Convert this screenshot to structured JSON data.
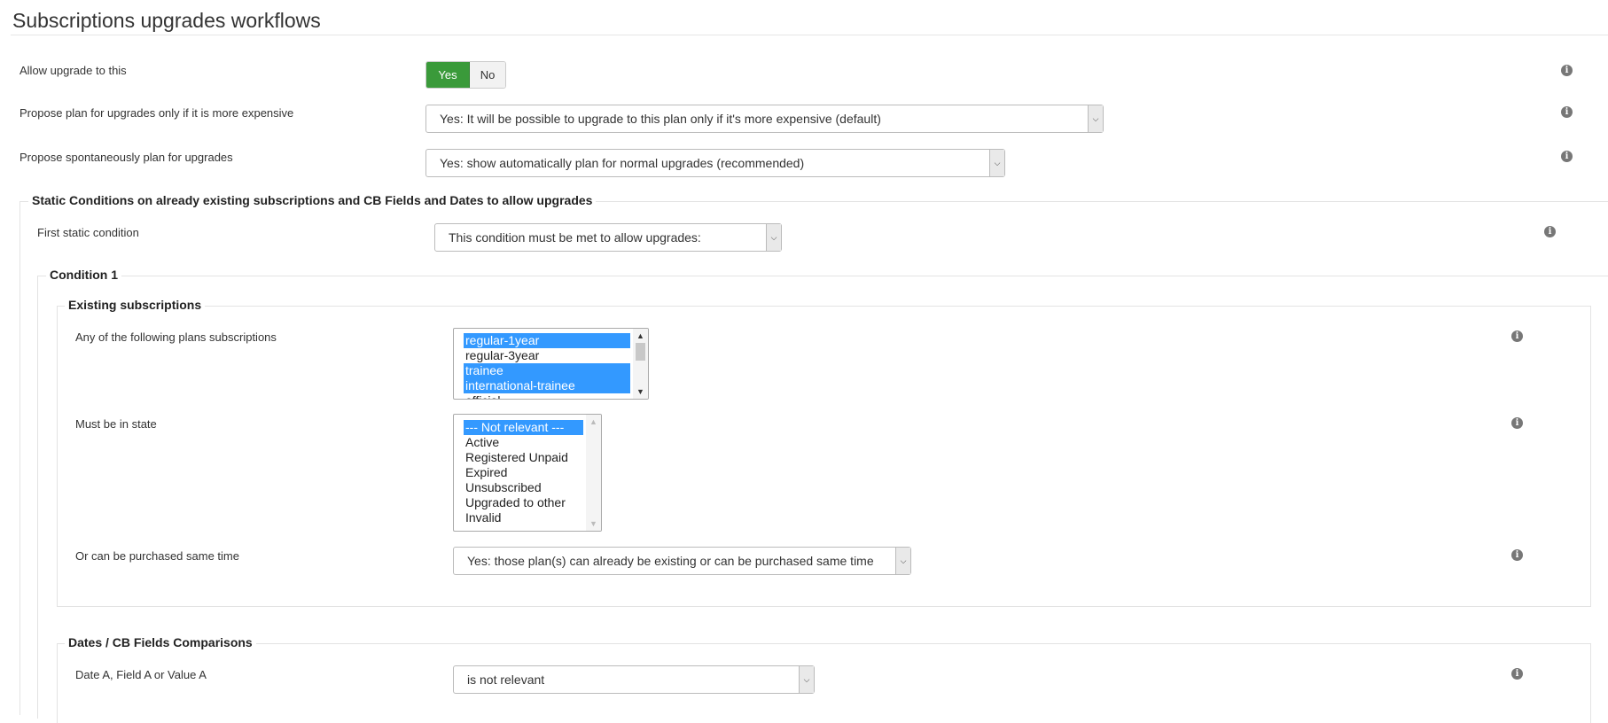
{
  "page": {
    "title": "Subscriptions upgrades workflows"
  },
  "upgrade": {
    "allow_label": "Allow upgrade to this",
    "toggle": {
      "yes": "Yes",
      "no": "No",
      "selected": "Yes"
    },
    "propose_expensive_label": "Propose plan for upgrades only if it is more expensive",
    "propose_expensive_value": "Yes: It will be possible to upgrade to this plan only if it's more expensive (default)",
    "propose_spontaneous_label": "Propose spontaneously plan for upgrades",
    "propose_spontaneous_value": "Yes: show automatically plan for normal upgrades (recommended)"
  },
  "static_conditions": {
    "legend": "Static Conditions on already existing subscriptions and CB Fields and Dates to allow upgrades",
    "first_label": "First static condition",
    "first_value": "This condition must be met to allow upgrades:",
    "condition1": {
      "legend": "Condition 1",
      "existing": {
        "legend": "Existing subscriptions",
        "plans_label": "Any of the following plans subscriptions",
        "plans_options": [
          {
            "label": "regular-1year",
            "selected": true
          },
          {
            "label": "regular-3year",
            "selected": false
          },
          {
            "label": "trainee",
            "selected": true
          },
          {
            "label": "international-trainee",
            "selected": true
          },
          {
            "label": "official",
            "selected": false
          }
        ],
        "state_label": "Must be in state",
        "state_options": [
          {
            "label": "--- Not relevant ---",
            "selected": true
          },
          {
            "label": "Active",
            "selected": false
          },
          {
            "label": "Registered Unpaid",
            "selected": false
          },
          {
            "label": "Expired",
            "selected": false
          },
          {
            "label": "Unsubscribed",
            "selected": false
          },
          {
            "label": "Upgraded to other",
            "selected": false
          },
          {
            "label": "Invalid",
            "selected": false
          }
        ],
        "purchase_label": "Or can be purchased same time",
        "purchase_value": "Yes: those plan(s) can already be existing or can be purchased same time"
      },
      "dates": {
        "legend": "Dates / CB Fields Comparisons",
        "date_a_label": "Date A, Field A or Value A",
        "date_a_value": "is not relevant"
      }
    }
  },
  "icons": {
    "info": "info-icon",
    "dropdown": "chevron-down-icon",
    "scroll_up": "scroll-up-arrow",
    "scroll_down": "scroll-down-arrow"
  },
  "colors": {
    "toggle_active": "#3a9a3a",
    "selection": "#3399ff",
    "info_icon": "#777777"
  }
}
